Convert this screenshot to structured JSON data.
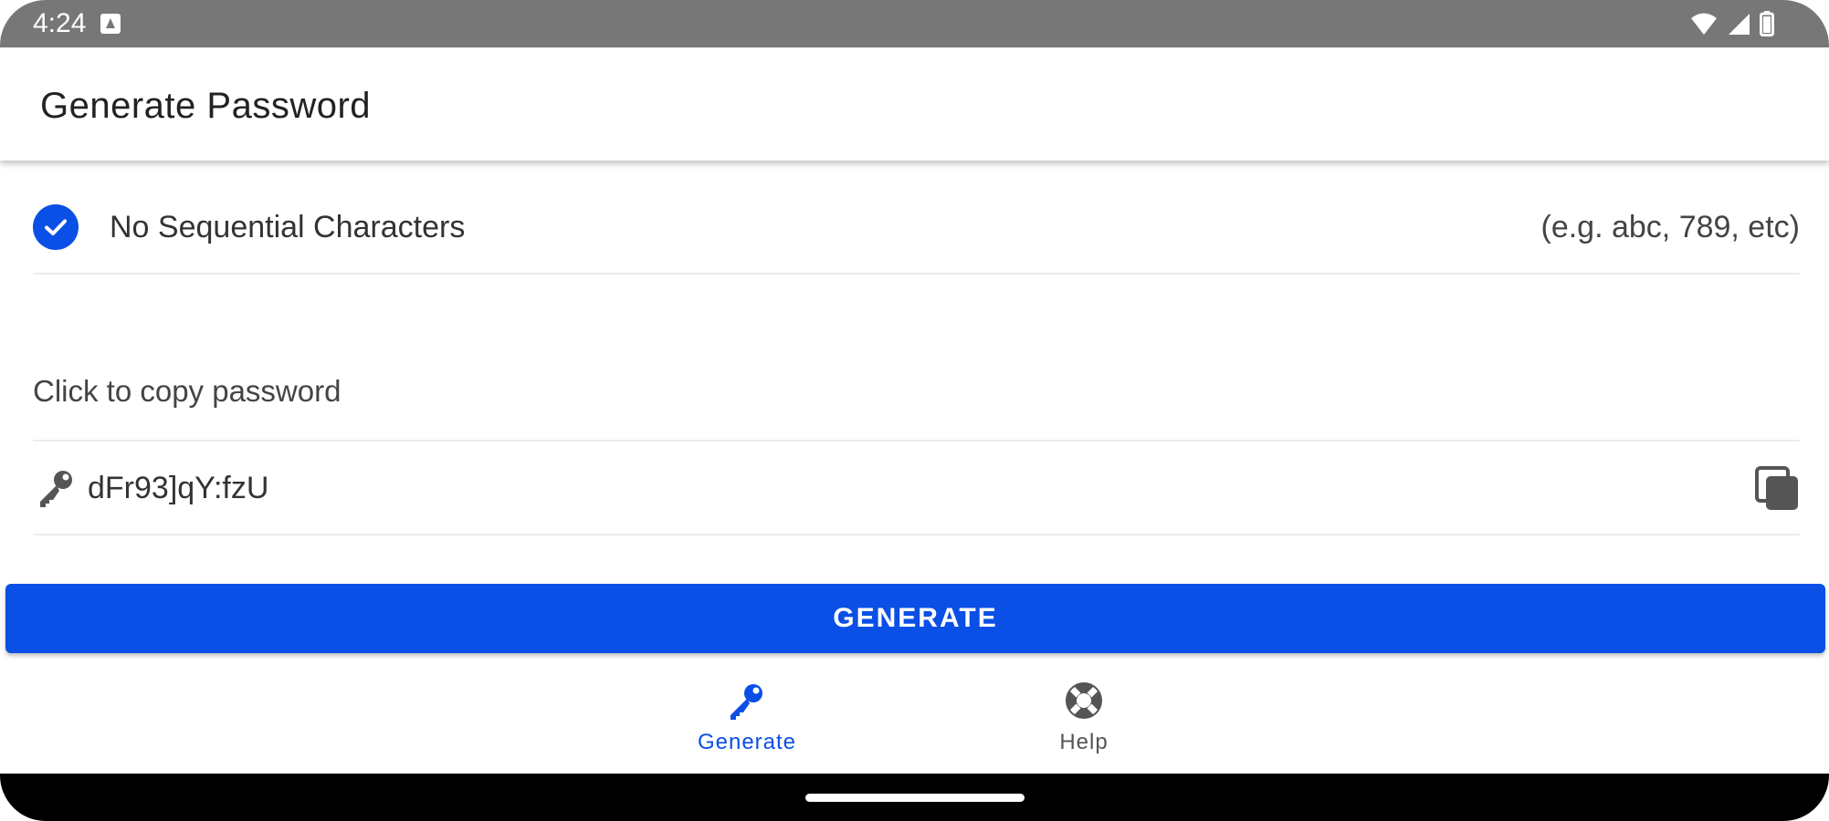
{
  "status_bar": {
    "time": "4:24",
    "icons": [
      "notification-icon",
      "wifi-icon",
      "signal-icon",
      "battery-icon"
    ]
  },
  "app_bar": {
    "title": "Generate Password"
  },
  "options": {
    "no_sequential": {
      "label": "No Sequential Characters",
      "hint": "(e.g. abc, 789, etc)",
      "checked": true
    }
  },
  "password": {
    "caption": "Click to copy password",
    "value": "dFr93]qY:fzU"
  },
  "actions": {
    "generate_label": "GENERATE"
  },
  "bottom_nav": {
    "items": [
      {
        "label": "Generate",
        "icon": "key-icon",
        "active": true
      },
      {
        "label": "Help",
        "icon": "lifebuoy-icon",
        "active": false
      }
    ]
  },
  "colors": {
    "accent": "#0a4fe6",
    "status_bar": "#777777",
    "inactive_nav": "#555555"
  }
}
